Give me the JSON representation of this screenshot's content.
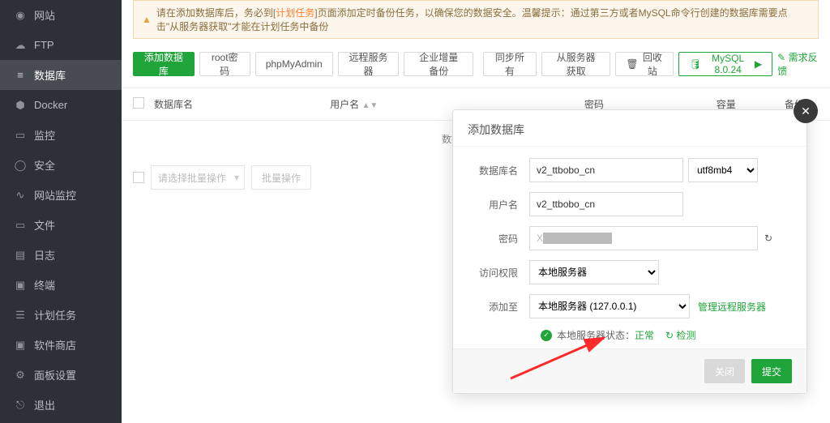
{
  "sidebar": {
    "items": [
      {
        "label": "网站"
      },
      {
        "label": "FTP"
      },
      {
        "label": "数据库"
      },
      {
        "label": "Docker"
      },
      {
        "label": "监控"
      },
      {
        "label": "安全"
      },
      {
        "label": "网站监控"
      },
      {
        "label": "文件"
      },
      {
        "label": "日志"
      },
      {
        "label": "终端"
      },
      {
        "label": "计划任务"
      },
      {
        "label": "软件商店"
      },
      {
        "label": "面板设置"
      },
      {
        "label": "退出"
      }
    ],
    "activeIndex": 2
  },
  "warning": {
    "pre": "请在添加数据库后，务必到[",
    "link": "计划任务",
    "post": "]页面添加定时备份任务，以确保您的数据安全。温馨提示：通过第三方或者MySQL命令行创建的数据库需要点击\"从服务器获取\"才能在计划任务中备份"
  },
  "toolbar": {
    "add": "添加数据库",
    "root": "root密码",
    "pma": "phpMyAdmin",
    "remote": "远程服务器",
    "incr": "企业增量备份",
    "sync": "同步所有",
    "fetch": "从服务器获取",
    "recycle": "回收站",
    "mysql": "MySQL 8.0.24",
    "feedback": "需求反馈"
  },
  "table": {
    "cols": {
      "name": "数据库名",
      "user": "用户名",
      "pwd": "密码",
      "cap": "容量",
      "backup": "备份"
    },
    "empty": "数据库列表为空"
  },
  "batch": {
    "select": "请选择批量操作",
    "btn": "批量操作"
  },
  "modal": {
    "title": "添加数据库",
    "labels": {
      "name": "数据库名",
      "user": "用户名",
      "pwd": "密码",
      "perm": "访问权限",
      "addTo": "添加至"
    },
    "values": {
      "name": "v2_ttbobo_cn",
      "charset": "utf8mb4",
      "user": "v2_ttbobo_cn",
      "pwd": "X██████████",
      "perm": "本地服务器",
      "addTo": "本地服务器 (127.0.0.1)"
    },
    "manageRemote": "管理远程服务器",
    "status": {
      "prefix": "本地服务器状态：",
      "ok": "正常",
      "check": "检测"
    },
    "footer": {
      "close": "关闭",
      "submit": "提交"
    }
  }
}
